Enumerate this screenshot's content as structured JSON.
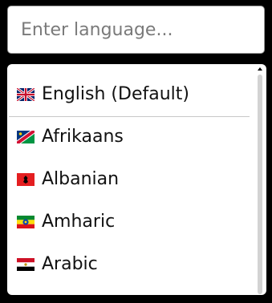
{
  "search": {
    "placeholder": "Enter language...",
    "value": ""
  },
  "languages": [
    {
      "label": "English (Default)",
      "flag": "uk-flag-icon"
    },
    {
      "label": "Afrikaans",
      "flag": "namibia-flag-icon"
    },
    {
      "label": "Albanian",
      "flag": "albania-flag-icon"
    },
    {
      "label": "Amharic",
      "flag": "ethiopia-flag-icon"
    },
    {
      "label": "Arabic",
      "flag": "egypt-flag-icon"
    }
  ],
  "colors": {
    "background": "#000000",
    "panel": "#ffffff",
    "text": "#111111",
    "placeholder": "#7a7a7a",
    "scroll_thumb": "#d3d3d3"
  }
}
